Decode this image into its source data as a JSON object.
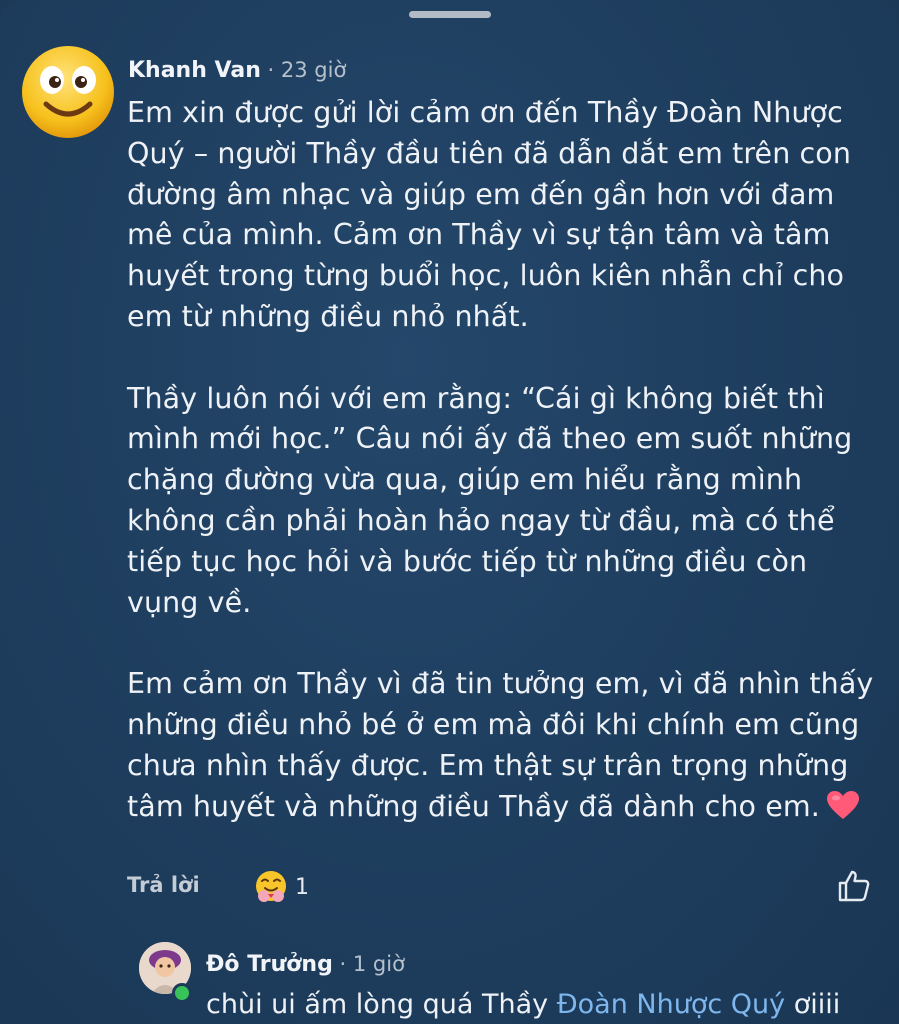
{
  "comment": {
    "author": "Khanh Van",
    "time": "23 giờ",
    "paragraphs": [
      "Em xin được gửi lời cảm ơn đến Thầy Đoàn Nhược Quý – người Thầy đầu tiên đã dẫn dắt em trên con đường âm nhạc và giúp em đến gần hơn với đam mê của mình. Cảm ơn Thầy vì sự tận tâm và tâm huyết trong từng buổi học, luôn kiên nhẫn chỉ cho em từ những điều nhỏ nhất.",
      "Thầy luôn nói với em rằng: “Cái gì không biết thì mình mới học.” Câu nói ấy đã theo em suốt những chặng đường vừa qua, giúp em hiểu rằng mình không cần phải hoàn hảo ngay từ đầu, mà có thể tiếp tục học hỏi và bước tiếp từ những điều còn vụng về.",
      "Em cảm ơn Thầy vì đã tin tưởng em, vì đã nhìn thấy những điều nhỏ bé ở em mà đôi khi chính em cũng chưa nhìn thấy được. Em thật sự trân trọng những tâm huyết và những điều Thầy đã dành cho em."
    ],
    "reply_label": "Trả lời",
    "reaction_count": "1",
    "icons": {
      "avatar": "smiley-face-icon",
      "heart": "red-heart-icon",
      "reaction": "hugging-face-icon",
      "like": "thumbs-up-icon"
    }
  },
  "reply": {
    "author": "Đô Trưởng",
    "time": "1 giờ",
    "text": "chùi ui ấm lòng quá Thầy ",
    "mention": "Đoàn Nhược Quý",
    "suffix": " ơiiii"
  },
  "separator": " · ",
  "colors": {
    "background": "#1f3f60",
    "mention": "#7fb6ec",
    "heart": "#ff5a78",
    "online": "#37c25a"
  }
}
